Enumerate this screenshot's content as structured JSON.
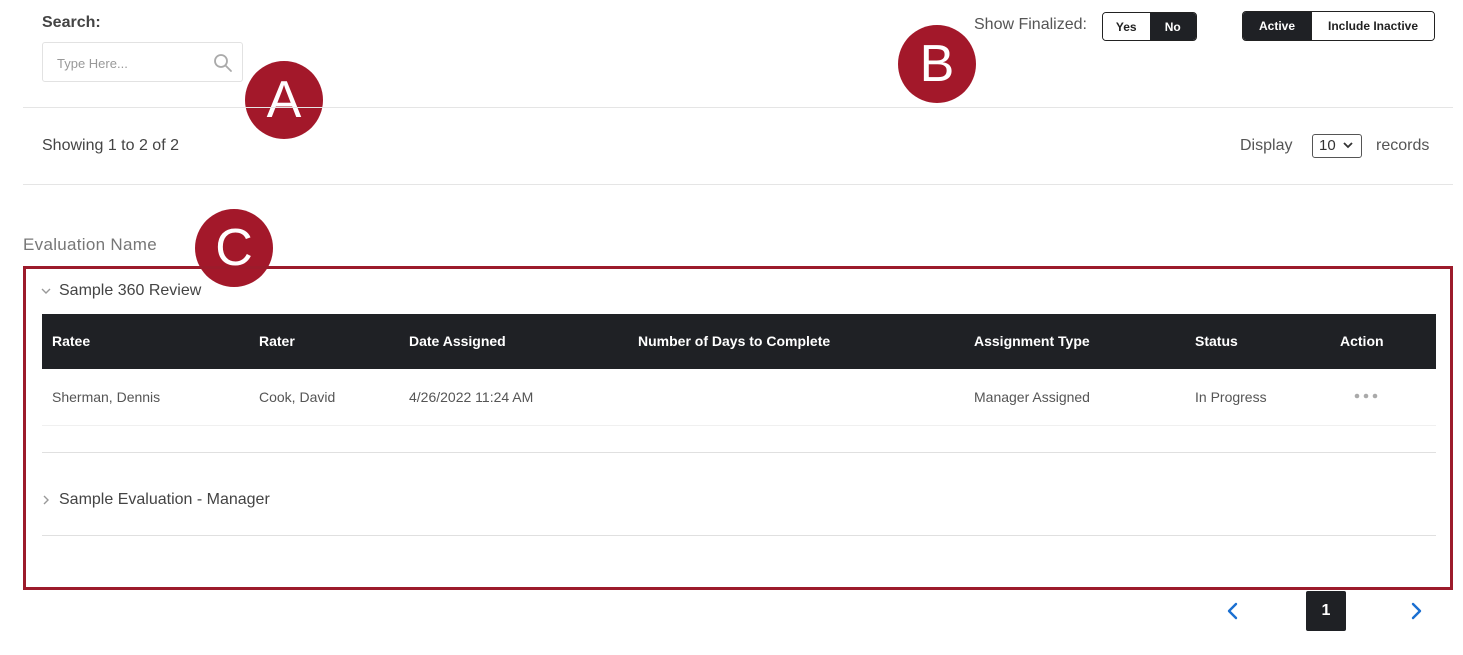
{
  "search": {
    "label": "Search:",
    "placeholder": "Type Here...",
    "value": ""
  },
  "markers": [
    "A",
    "B",
    "C"
  ],
  "filters": {
    "finalized_label": "Show Finalized:",
    "finalized_options": [
      "Yes",
      "No"
    ],
    "finalized_selected": "No",
    "status_options": [
      "Active",
      "Include Inactive"
    ],
    "status_selected": "Active"
  },
  "summary": {
    "showing": "Showing 1 to 2 of 2",
    "display_label": "Display",
    "display_value": "10",
    "records_label": "records"
  },
  "section": {
    "heading": "Evaluation Name"
  },
  "groups": [
    {
      "name": "Sample 360 Review",
      "expanded": true,
      "columns": [
        "Ratee",
        "Rater",
        "Date Assigned",
        "Number of Days to Complete",
        "Assignment Type",
        "Status",
        "Action"
      ],
      "rows": [
        {
          "ratee": "Sherman, Dennis",
          "rater": "Cook, David",
          "date_assigned": "4/26/2022 11:24 AM",
          "days_to_complete": "",
          "assignment_type": "Manager Assigned",
          "status": "In Progress"
        }
      ]
    },
    {
      "name": "Sample Evaluation - Manager",
      "expanded": false
    }
  ],
  "pagination": {
    "current_page": "1"
  },
  "colors": {
    "dark": "#1f2125",
    "accent_red": "#a3182a",
    "link_blue": "#1a6fd1"
  },
  "icons": {
    "search": "search-icon",
    "expanded": "chevron-down-icon",
    "collapsed": "chevron-right-icon",
    "action": "more-horizontal-icon",
    "prev": "chevron-left-icon",
    "next": "chevron-right-icon"
  }
}
